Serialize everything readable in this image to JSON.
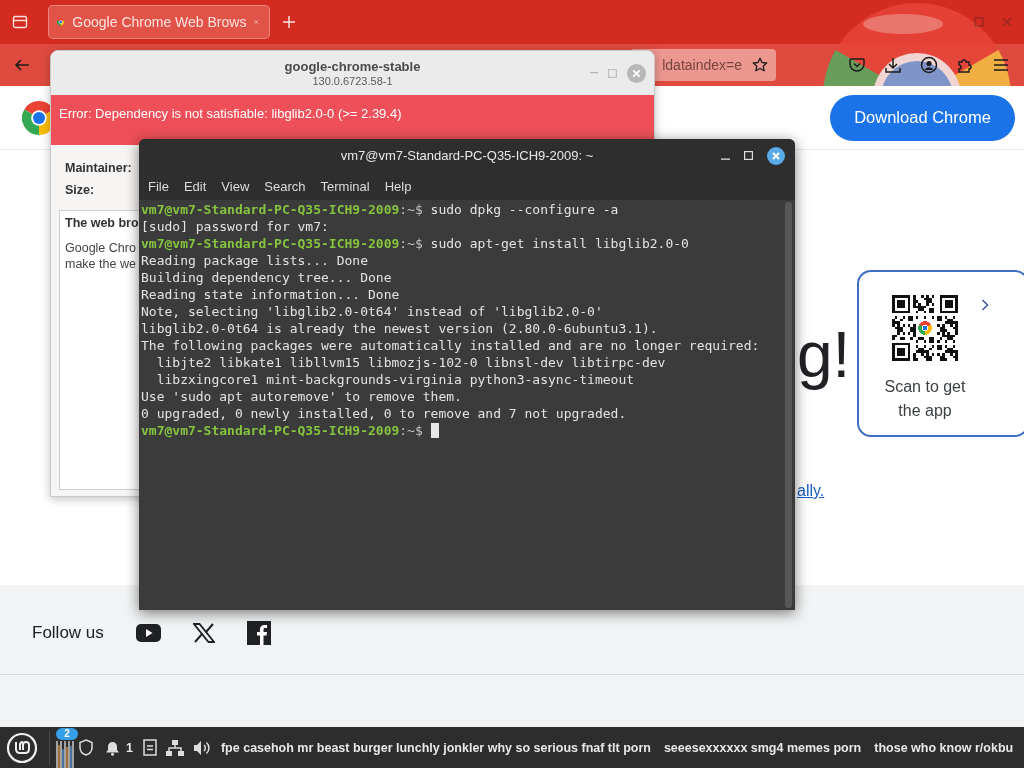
{
  "browser": {
    "tabs": [
      {
        "title": "Google Chrome Web Brows",
        "selected": true
      }
    ],
    "address_bar": {
      "value": "ldataindex=e"
    }
  },
  "page": {
    "download_button": "Download Chrome",
    "headline_fragment": "g!",
    "link_fragment": "ally.",
    "qr_card": {
      "caption": "Scan to get the app"
    },
    "footer": {
      "follow_label": "Follow us"
    }
  },
  "installer_dialog": {
    "title": "google-chrome-stable",
    "subtitle": "130.0.6723.58-1",
    "error": "Error: Dependency is not satisfiable: libglib2.0-0 (>= 2.39.4)",
    "fields": [
      "Maintainer:",
      "Size:"
    ],
    "description": {
      "heading": "The web bro",
      "lines": [
        "Google Chro",
        "make the we"
      ]
    }
  },
  "terminal": {
    "title": "vm7@vm7-Standard-PC-Q35-ICH9-2009: ~",
    "menu": [
      "File",
      "Edit",
      "View",
      "Search",
      "Terminal",
      "Help"
    ],
    "lines": [
      {
        "kind": "prompt",
        "user_host": "vm7@vm7-Standard-PC-Q35-ICH9-2009",
        "path": ":~$",
        "command": "sudo dpkg --configure -a",
        "cursor": false
      },
      {
        "kind": "output",
        "text": "[sudo] password for vm7:",
        "cursor": false
      },
      {
        "kind": "prompt",
        "user_host": "vm7@vm7-Standard-PC-Q35-ICH9-2009",
        "path": ":~$",
        "command": "sudo apt-get install libglib2.0-0",
        "cursor": false
      },
      {
        "kind": "output",
        "text": "Reading package lists... Done",
        "cursor": false
      },
      {
        "kind": "output",
        "text": "Building dependency tree... Done",
        "cursor": false
      },
      {
        "kind": "output",
        "text": "Reading state information... Done",
        "cursor": false
      },
      {
        "kind": "output",
        "text": "Note, selecting 'libglib2.0-0t64' instead of 'libglib2.0-0'",
        "cursor": false
      },
      {
        "kind": "output",
        "text": "libglib2.0-0t64 is already the newest version (2.80.0-6ubuntu3.1).",
        "cursor": false
      },
      {
        "kind": "output",
        "text": "The following packages were automatically installed and are no longer required:",
        "cursor": false
      },
      {
        "kind": "output",
        "text": "  libjte2 libkate1 libllvm15 libmozjs-102-0 libnsl-dev libtirpc-dev",
        "cursor": false
      },
      {
        "kind": "output",
        "text": "  libzxingcore1 mint-backgrounds-virginia python3-async-timeout",
        "cursor": false
      },
      {
        "kind": "output",
        "text": "Use 'sudo apt autoremove' to remove them.",
        "cursor": false
      },
      {
        "kind": "output",
        "text": "0 upgraded, 0 newly installed, 0 to remove and 7 not upgraded.",
        "cursor": false
      },
      {
        "kind": "prompt",
        "user_host": "vm7@vm7-Standard-PC-Q35-ICH9-2009",
        "path": ":~$",
        "cursor": true
      }
    ]
  },
  "taskbar": {
    "badge": "2",
    "notification_count": "1",
    "ticker": [
      "fpe casehoh mr beast burger lunchly jonkler why so serious fnaf tlt porn",
      "seeesexxxxxx smg4 memes porn",
      "those who know r/okbu"
    ]
  }
}
